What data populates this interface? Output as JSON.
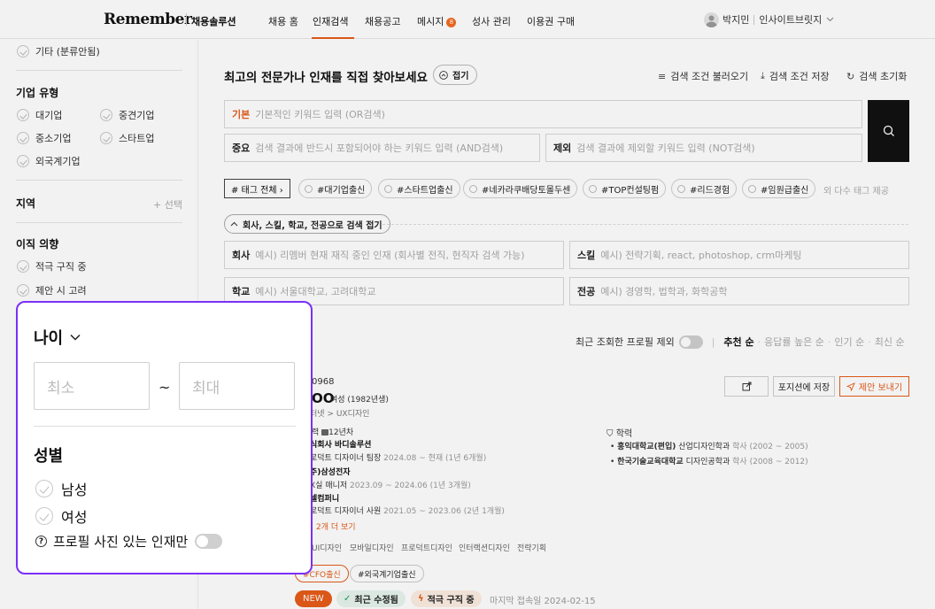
{
  "header": {
    "logo": "Remember",
    "logo_sub": "채용솔루션",
    "nav": [
      "채용 홈",
      "인재검색",
      "채용공고",
      "메시지",
      "성사 관리",
      "이용권 구매"
    ],
    "message_badge": "8",
    "user_name": "박지민",
    "company": "인사이트브릿지"
  },
  "sidebar": {
    "etc_item": "기타 (분류안됨)",
    "company_type": {
      "title": "기업 유형",
      "items": [
        "대기업",
        "중견기업",
        "중소기업",
        "스타트업",
        "외국계기업"
      ]
    },
    "region": {
      "title": "지역",
      "add_label": "+ 선택"
    },
    "intent": {
      "title": "이직 의향",
      "items": [
        "적극 구직 중",
        "제안 시 고려"
      ]
    }
  },
  "main": {
    "title": "최고의 전문가나 인재를 직접 찾아보세요",
    "collapse_label": "접기",
    "actions": {
      "load": "검색 조건 불러오기",
      "save": "검색 조건 저장",
      "reset": "검색 초기화"
    },
    "basic": {
      "label": "기본",
      "placeholder": "기본적인 키워드 입력 (OR검색)"
    },
    "must": {
      "label": "중요",
      "placeholder": "검색 결과에 반드시 포함되어야 하는 키워드 입력 (AND검색)"
    },
    "exclude": {
      "label": "제외",
      "placeholder": "검색 결과에 제외할 키워드 입력 (NOT검색)"
    },
    "tag_all": "# 태그 전체 ›",
    "tags": [
      "#대기업출신",
      "#스타트업출신",
      "#네카라쿠배당토몰두센",
      "#TOP컨설팅펌",
      "#리드경험",
      "#임원급출신"
    ],
    "tag_more": "외 다수 태그 제공",
    "advanced_label": "회사, 스킬, 학교, 전공으로 검색 접기",
    "company_field": {
      "label": "회사",
      "placeholder": "예시) 리멤버 현재 재직 중인 인재 (회사별 전직, 현직자 검색 가능)"
    },
    "skill_field": {
      "label": "스킬",
      "placeholder": "예시) 전략기획, react, photoshop, crm마케팅"
    },
    "school_field": {
      "label": "학교",
      "placeholder": "예시) 서울대학교, 고려대학교"
    },
    "major_field": {
      "label": "전공",
      "placeholder": "예시) 경영학, 법학과, 화학공학"
    }
  },
  "results": {
    "recent_exclude": "최근 조회한 프로필 제외",
    "sort_options": [
      "추천 순",
      "응답률 높은 순",
      "인기 순",
      "최신 순"
    ],
    "profile": {
      "id_fragment": "0968",
      "name_fragment": "OO",
      "gender_age": "여성 (1982년생)",
      "category": "터넷 > UX디자인",
      "career_label": "력",
      "career_years": "12년차",
      "careers": [
        {
          "company": "식회사 바디솔루션",
          "role": "로덕트 디자이너",
          "title": "팀장",
          "period": "2024.08 ~ 현재 (1년 6개월)"
        },
        {
          "company": "주)삼성전자",
          "role": "X실",
          "title": "매니저",
          "period": "2023.09 ~ 2024.06 (1년 3개월)"
        },
        {
          "company": "셀컴퍼니",
          "role": "로덕트 디자이너",
          "title": "사원",
          "period": "2021.05 ~ 2023.06 (2년 1개월)"
        }
      ],
      "more_careers": "2개 더 보기",
      "education_title": "학력",
      "education": [
        {
          "school": "홍익대학교(편입)",
          "major": "산업디자인학과",
          "degree": "학사",
          "period": "(2002 ~ 2005)"
        },
        {
          "school": "한국기술교육대학교",
          "major": "디자인공학과",
          "degree": "학사",
          "period": "(2008 ~ 2012)"
        }
      ],
      "skills": [
        "UI디자인",
        "모바일디자인",
        "프로덕트디자인",
        "인터랙션디자인",
        "전략기획"
      ],
      "tags": [
        "#CFO출신",
        "#외국계기업출신"
      ],
      "badges": {
        "new": "NEW",
        "updated": "최근 수정됨",
        "seeking": "적극 구직 중"
      },
      "last_login": "마지막 접속일 2024-02-15",
      "buttons": {
        "save_position": "포지션에 저장",
        "propose": "제안 보내기"
      }
    }
  },
  "popup": {
    "age_title": "나이",
    "min_placeholder": "최소",
    "max_placeholder": "최대",
    "tilde": "~",
    "gender_title": "성별",
    "genders": [
      "남성",
      "여성"
    ],
    "photo_only": "프로필 사진 있는 인재만"
  },
  "colors": {
    "accent": "#e65c19",
    "popup_border": "#7b2ff7",
    "search_button": "#111111"
  }
}
